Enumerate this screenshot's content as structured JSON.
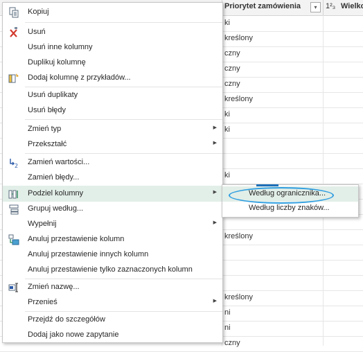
{
  "column_header": {
    "title": "Priorytet zamówienia",
    "dropdown_glyph": "▾",
    "type_icon": "1²₃",
    "next_title": "Wielko"
  },
  "rows": [
    {
      "value": "ki"
    },
    {
      "value": "kreślony"
    },
    {
      "value": "czny"
    },
    {
      "value": "czny"
    },
    {
      "value": "czny"
    },
    {
      "value": "kreślony"
    },
    {
      "value": "ki"
    },
    {
      "value": "ki"
    },
    {
      "value": ""
    },
    {
      "value": ""
    },
    {
      "value": "ki"
    },
    {
      "value": ""
    },
    {
      "value": ""
    },
    {
      "value": ""
    },
    {
      "value": "kreślony"
    },
    {
      "value": ""
    },
    {
      "value": ""
    },
    {
      "value": ""
    },
    {
      "value": "kreślony"
    },
    {
      "value": "ni"
    },
    {
      "value": "ni"
    },
    {
      "value": "czny"
    }
  ],
  "menu": {
    "copy": "Kopiuj",
    "remove": "Usuń",
    "remove_other": "Usuń inne kolumny",
    "duplicate": "Duplikuj kolumnę",
    "add_from_examples": "Dodaj kolumnę z przykładów...",
    "remove_duplicates": "Usuń duplikaty",
    "remove_errors": "Usuń błędy",
    "change_type": "Zmień typ",
    "transform": "Przekształć",
    "replace_values": "Zamień wartości...",
    "replace_errors": "Zamień błędy...",
    "split_column": "Podziel kolumny",
    "group_by": "Grupuj według...",
    "fill": "Wypełnij",
    "unpivot": "Anuluj przestawienie kolumn",
    "unpivot_other": "Anuluj przestawienie innych kolumn",
    "unpivot_selected": "Anuluj przestawienie tylko zaznaczonych kolumn",
    "rename": "Zmień nazwę...",
    "move": "Przenieś",
    "drill_down": "Przejdź do szczegółów",
    "add_as_query": "Dodaj jako nowe zapytanie",
    "submenu_arrow": "▶"
  },
  "submenu": {
    "by_delimiter": "Według ogranicznika...",
    "by_chars": "Według liczby znaków..."
  },
  "icons": {
    "copy": "copy-icon",
    "remove": "remove-column-icon",
    "add_from_examples": "add-column-from-examples-icon",
    "replace_values": "replace-values-icon",
    "split_column": "split-column-icon",
    "group_by": "group-by-icon",
    "unpivot": "unpivot-icon",
    "rename": "rename-icon"
  },
  "colors": {
    "hover": "#e2eee8",
    "highlight_ellipse": "#2f9ee0",
    "remove_icon": "#d23b2f"
  }
}
